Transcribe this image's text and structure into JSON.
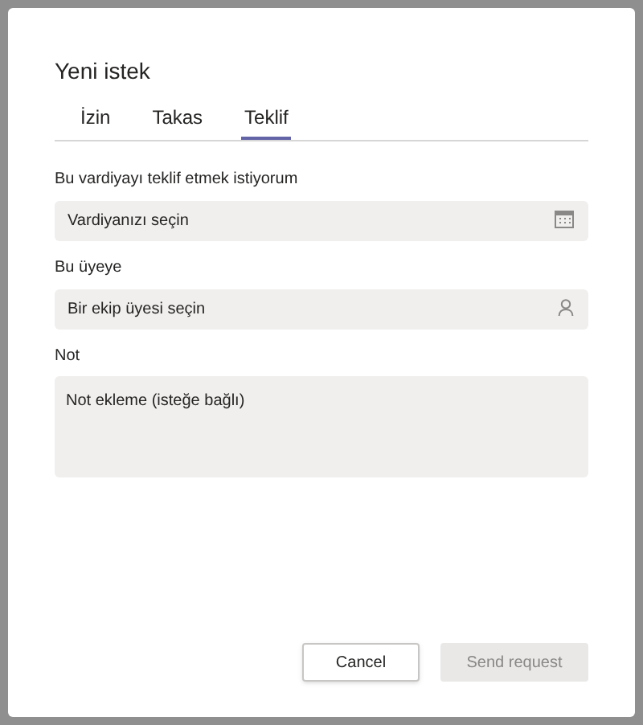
{
  "dialog": {
    "title": "Yeni istek"
  },
  "tabs": [
    {
      "label": "İzin",
      "selected": false
    },
    {
      "label": "Takas",
      "selected": false
    },
    {
      "label": "Teklif",
      "selected": true
    }
  ],
  "fields": [
    {
      "kind": "shift",
      "label": "Bu vardiyayı teklif etmek istiyorum",
      "placeholder": "Vardiyanızı seçin"
    },
    {
      "kind": "member",
      "label": "Bu üyeye",
      "placeholder": "Bir ekip üyesi seçin"
    },
    {
      "kind": "note",
      "label": "Not",
      "placeholder": "Not ekleme (isteğe bağlı)"
    }
  ],
  "buttons": [
    {
      "label": "Cancel",
      "disabled": false,
      "primary": false
    },
    {
      "label": "Send request",
      "disabled": true,
      "primary": true
    }
  ]
}
